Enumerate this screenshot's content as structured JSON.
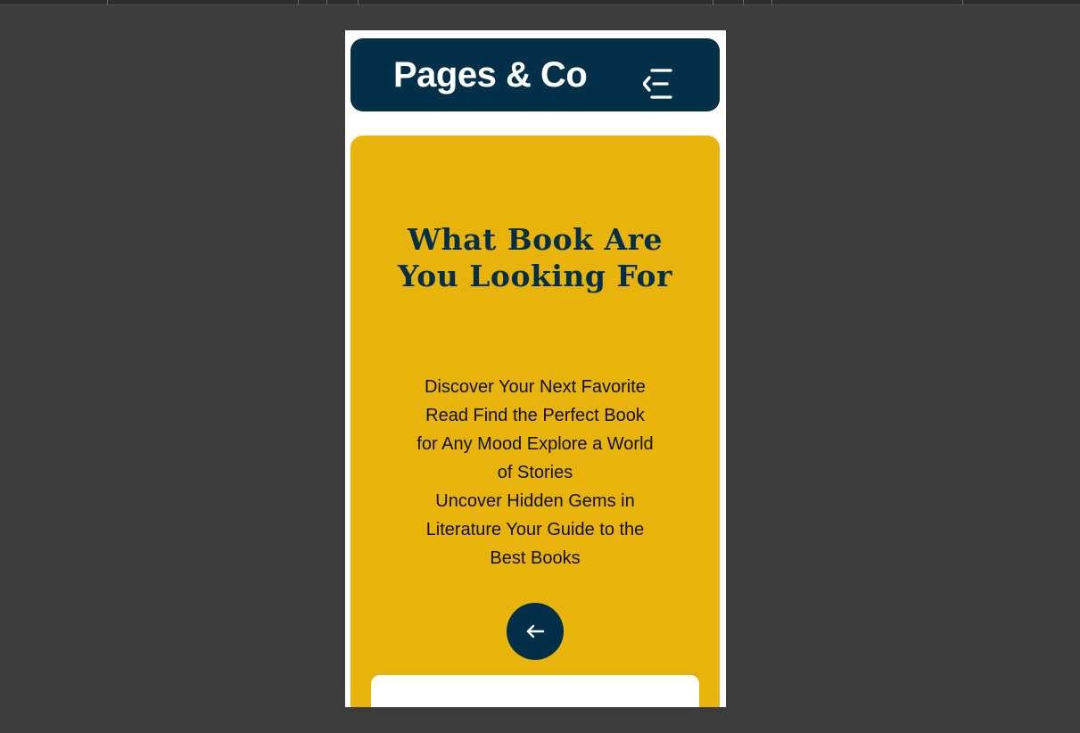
{
  "header": {
    "brand": "Pages & Co",
    "menu_icon": "menu-collapse-icon"
  },
  "hero": {
    "title": "What Book Are You Looking For",
    "description_lines": [
      "Discover Your Next Favorite Read Find the Perfect Book for Any Mood Explore a World of Stories",
      "Uncover Hidden Gems in Literature Your Guide to the Best Books"
    ],
    "arrow_icon": "arrow-left-icon"
  },
  "colors": {
    "navy": "#033048",
    "gold": "#e8b30a",
    "white": "#ffffff",
    "backdrop": "#3c3c3c"
  }
}
